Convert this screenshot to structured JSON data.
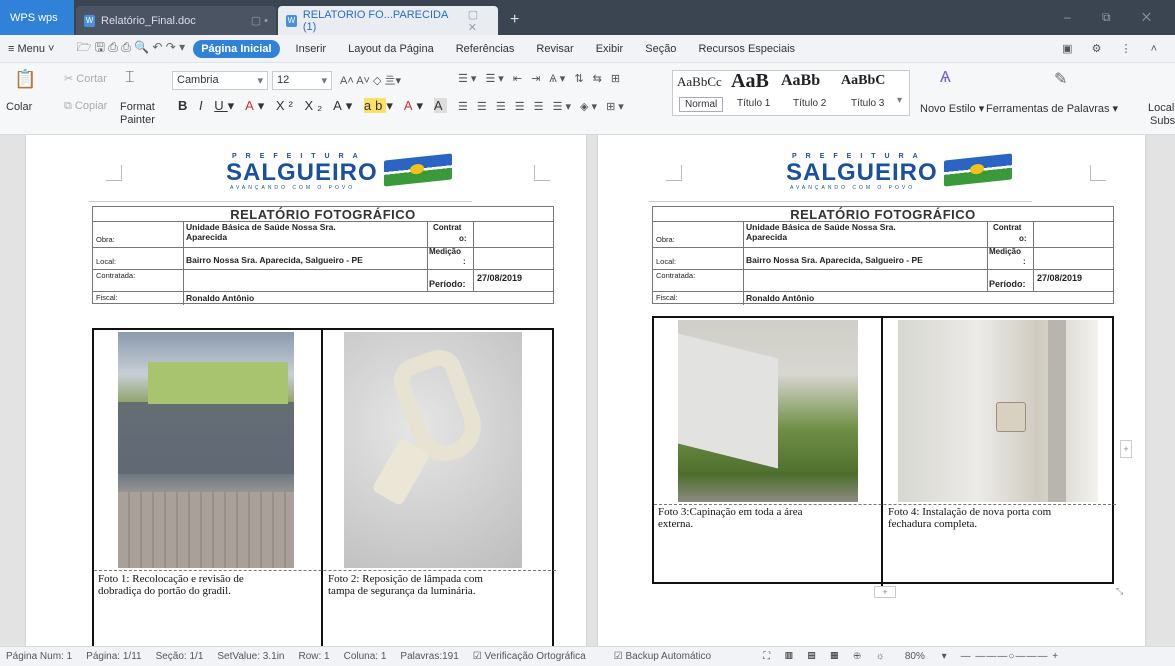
{
  "window": {
    "app_tab": "WPS wps",
    "tabs": [
      {
        "label": "Relatório_Final.doc"
      },
      {
        "label": "RELATORIO FO...PARECIDA (1)"
      }
    ]
  },
  "menu": {
    "menu_label": "≡ Menu ˅",
    "items": [
      "Página Inicial",
      "Inserir",
      "Layout da Página",
      "Referências",
      "Revisar",
      "Exibir",
      "Seção",
      "Recursos Especiais"
    ]
  },
  "ribbon": {
    "paste": "Colar",
    "cut": "Cortar",
    "copy": "Copiar",
    "format_painter_1": "Format",
    "format_painter_2": "Painter",
    "font_name": "Cambria",
    "font_size": "12",
    "styles": [
      {
        "preview": "AaBbCc",
        "label": "Normal"
      },
      {
        "preview": "AaB",
        "label": "Título 1"
      },
      {
        "preview": "AaBb",
        "label": "Título 2"
      },
      {
        "preview": "AaBbC",
        "label": "Título 3"
      }
    ],
    "new_style": "Novo Estilo",
    "word_tools": "Ferramentas de Palavras",
    "locate_1": "Local",
    "locate_2": "Subs"
  },
  "pages": [
    {
      "logo": {
        "pref": "PREFEITURA",
        "name": "SALGUEIRO",
        "sub": "AVANÇANDO COM O POVO"
      },
      "report": {
        "title": "RELATÓRIO FOTOGRÁFICO",
        "obra_label": "Obra:",
        "obra_value_1": "Unidade Básica de Saúde Nossa Sra.",
        "obra_value_2": "Aparecida",
        "contrat_label_1": "Contrat",
        "contrat_label_2": "o:",
        "local_label": "Local:",
        "local_value": "Bairro Nossa Sra. Aparecida, Salgueiro - PE",
        "medicao_label_1": "Medição",
        "medicao_label_2": ":",
        "contratada_label": "Contratada:",
        "periodo_label": "Período:",
        "periodo_value": "27/08/2019",
        "fiscal_label": "Fiscal:",
        "fiscal_value": "Ronaldo Antônio"
      },
      "photos": [
        {
          "caption_1": "Foto 1: Recolocação e revisão de",
          "caption_2": "dobradiça do portão do gradil."
        },
        {
          "caption_1": "Foto 2: Reposição de lâmpada com",
          "caption_2": "tampa de segurança da luminária."
        }
      ]
    },
    {
      "logo": {
        "pref": "PREFEITURA",
        "name": "SALGUEIRO",
        "sub": "AVANÇANDO COM O POVO"
      },
      "report": {
        "title": "RELATÓRIO FOTOGRÁFICO",
        "obra_label": "Obra:",
        "obra_value_1": "Unidade Básica de Saúde Nossa Sra.",
        "obra_value_2": "Aparecida",
        "contrat_label_1": "Contrat",
        "contrat_label_2": "o:",
        "local_label": "Local:",
        "local_value": "Bairro Nossa Sra. Aparecida, Salgueiro - PE",
        "medicao_label_1": "Medição",
        "medicao_label_2": ":",
        "contratada_label": "Contratada:",
        "periodo_label": "Período:",
        "periodo_value": "27/08/2019",
        "fiscal_label": "Fiscal:",
        "fiscal_value": "Ronaldo Antônio"
      },
      "photos": [
        {
          "caption_1": "Foto 3:Capinação em toda a área",
          "caption_2": "externa."
        },
        {
          "caption_1": "Foto 4: Instalação de nova porta com",
          "caption_2": "fechadura completa."
        }
      ]
    }
  ],
  "statusbar": {
    "page_num": "Página Num: 1",
    "page": "Página: 1/11",
    "section": "Seção: 1/1",
    "setvalue": "SetValue: 3.1in",
    "row": "Row: 1",
    "column": "Coluna: 1",
    "words": "Palavras:191",
    "spell": "Verificação Ortográfica",
    "backup": "Backup Automático",
    "zoom": "80%"
  }
}
